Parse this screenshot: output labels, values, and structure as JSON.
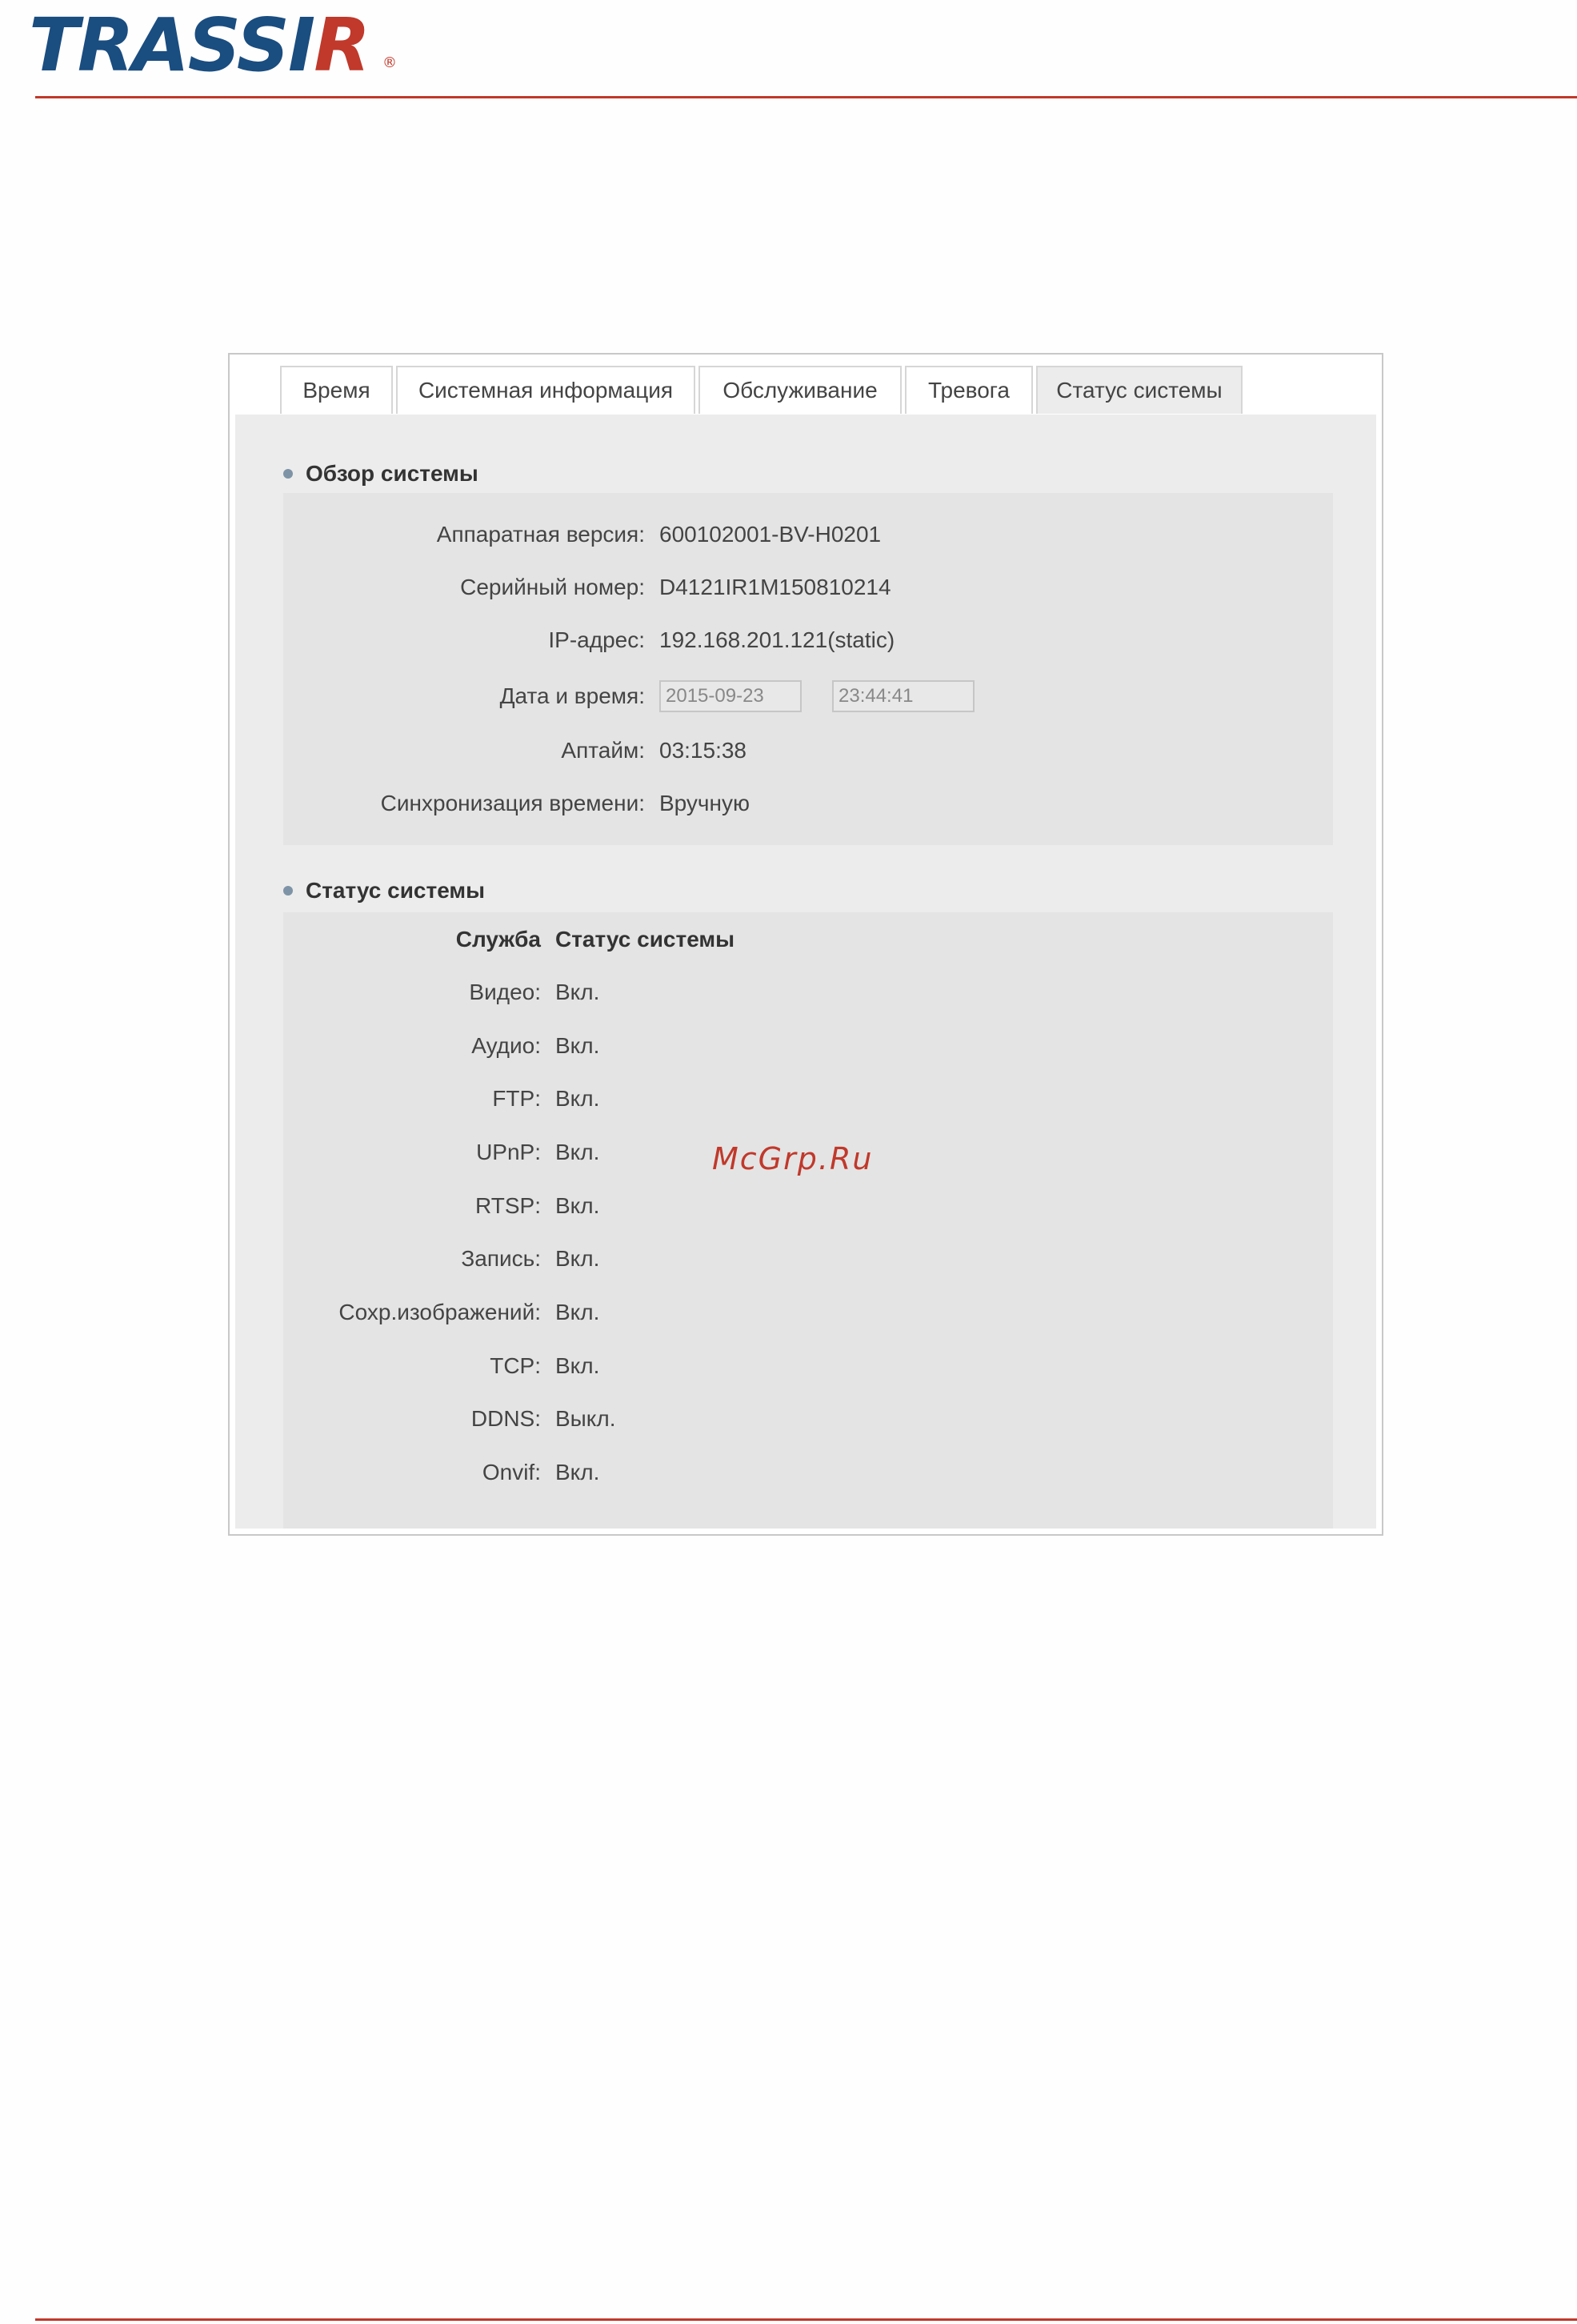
{
  "header": {
    "logo_main": "TRASSI",
    "logo_accent": "R",
    "logo_reg": "®"
  },
  "tabs": [
    {
      "label": "Время"
    },
    {
      "label": "Системная информация"
    },
    {
      "label": "Обслуживание"
    },
    {
      "label": "Тревога"
    },
    {
      "label": "Статус системы",
      "active": true
    }
  ],
  "overview": {
    "title": "Обзор системы",
    "hw_label": "Аппаратная версия:",
    "hw_value": "600102001-BV-H0201",
    "serial_label": "Серийный номер:",
    "serial_value": "D4121IR1M150810214",
    "ip_label": "IP-адрес:",
    "ip_value": "192.168.201.121(static)",
    "datetime_label": "Дата и время:",
    "date_value": "2015-09-23",
    "time_value": "23:44:41",
    "uptime_label": "Аптайм:",
    "uptime_value": "03:15:38",
    "sync_label": "Синхронизация времени:",
    "sync_value": "Вручную"
  },
  "status": {
    "title": "Статус системы",
    "col_service": "Служба",
    "col_status": "Статус системы",
    "rows": [
      {
        "service": "Видео:",
        "state": "Вкл."
      },
      {
        "service": "Аудио:",
        "state": "Вкл."
      },
      {
        "service": "FTP:",
        "state": "Вкл."
      },
      {
        "service": "UPnP:",
        "state": "Вкл."
      },
      {
        "service": "RTSP:",
        "state": "Вкл."
      },
      {
        "service": "Запись:",
        "state": "Вкл."
      },
      {
        "service": "Сохр.изображений:",
        "state": "Вкл."
      },
      {
        "service": "TCP:",
        "state": "Вкл."
      },
      {
        "service": "DDNS:",
        "state": "Выкл."
      },
      {
        "service": "Onvif:",
        "state": "Вкл."
      }
    ]
  },
  "watermark": "McGrp.Ru",
  "colors": {
    "brand_blue": "#1a4d80",
    "brand_red": "#c0392b",
    "panel_bg": "#ececec"
  }
}
